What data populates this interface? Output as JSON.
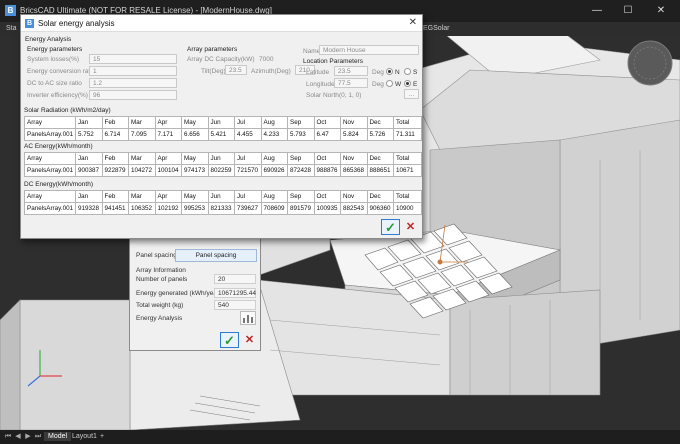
{
  "app": {
    "window_title": "BricsCAD Ultimate (NOT FOR RESALE License) - [ModernHouse.dwg]",
    "logo": "B",
    "tabs": [
      "Sta",
      "EGSolar"
    ]
  },
  "status": {
    "tabs": [
      "Model",
      "Layout1",
      "+"
    ]
  },
  "dialog": {
    "title": "Solar energy analysis",
    "close": "✕",
    "section": "Energy Analysis",
    "energy_parameters": {
      "heading": "Energy parameters",
      "rows": [
        {
          "label": "System losses(%)",
          "value": "15"
        },
        {
          "label": "Energy conversion ratio",
          "value": "1"
        },
        {
          "label": "DC to AC size ratio",
          "value": "1.2"
        },
        {
          "label": "Inverter efficiency(%)",
          "value": "96"
        }
      ]
    },
    "array_parameters": {
      "heading": "Array parameters",
      "capacity_label": "Array DC Capacity(kW)",
      "capacity_value": "7000",
      "tilt_label": "Tilt(Deg)",
      "tilt_value": "23.5",
      "azimuth_label": "Azimuth(Deg)",
      "azimuth_value": "210"
    },
    "location": {
      "name_label": "Name",
      "name_value": "Modern House",
      "heading": "Location Parameters",
      "latitude_label": "Latitude",
      "latitude_value": "23.5",
      "longitude_label": "Longitude",
      "longitude_value": "77.5",
      "deg": "Deg",
      "n": "N",
      "s": "S",
      "w": "W",
      "e": "E",
      "north_label": "Solar North",
      "north_value": "(0, 1, 0)",
      "north_button": "..."
    },
    "months": [
      "Array",
      "Jan",
      "Feb",
      "Mar",
      "Apr",
      "May",
      "Jun",
      "Jul",
      "Aug",
      "Sep",
      "Oct",
      "Nov",
      "Dec",
      "Total"
    ],
    "solar_radiation": {
      "title": "Solar Radiation (kWh/m2/day)",
      "row": [
        "PanelsArray.001",
        "5.752",
        "6.714",
        "7.095",
        "7.171",
        "6.656",
        "5.421",
        "4.455",
        "4.233",
        "5.793",
        "6.47",
        "5.824",
        "5.726",
        "71.311"
      ]
    },
    "ac_energy": {
      "title": "AC Energy(kWh/month)",
      "row": [
        "PanelsArray.001",
        "900387",
        "922879",
        "104272",
        "100104",
        "974173",
        "802259",
        "721570",
        "690926",
        "872428",
        "988876",
        "865368",
        "888651",
        "10671"
      ]
    },
    "dc_energy": {
      "title": "DC Energy(kWh/month)",
      "row": [
        "PanelsArray.001",
        "919328",
        "941451",
        "106352",
        "102192",
        "995253",
        "821333",
        "739627",
        "708609",
        "891579",
        "100935",
        "882543",
        "906360",
        "10900"
      ]
    },
    "ok": "✓",
    "cancel": "✕"
  },
  "panel_dialog": {
    "spacing_label": "Panel spacing",
    "spacing_button": "Panel spacing",
    "array_info": "Array Information",
    "panels_label": "Number of panels",
    "panels_value": "20",
    "generated_label": "Energy generated (kWh/year)",
    "generated_value": "10671295.44",
    "weight_label": "Total weight (kg)",
    "weight_value": "540",
    "analysis_label": "Energy Analysis",
    "ok": "✓",
    "cancel": "✕"
  },
  "colors": {
    "accent": "#2e7bd3",
    "ok_green": "#2c9a36",
    "cancel_red": "#c02424",
    "viewport_bg": "#2e2e2e"
  }
}
